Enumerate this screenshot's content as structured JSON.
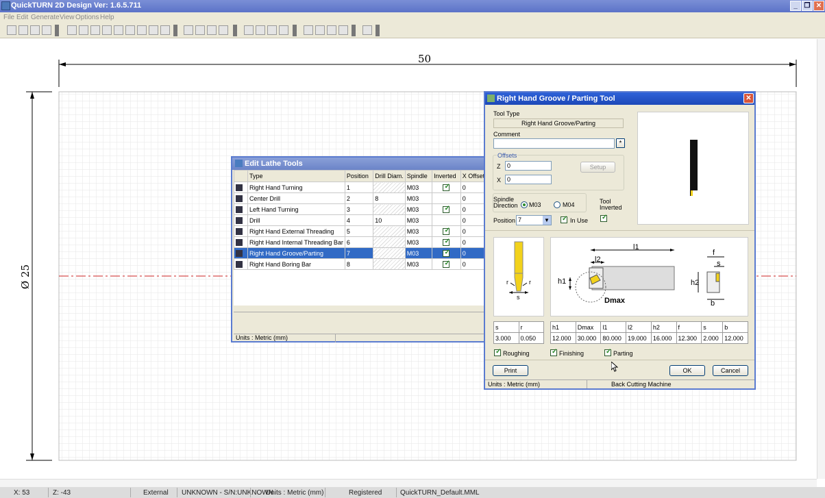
{
  "app": {
    "title": "QuickTURN 2D Design Ver: 1.6.5.711"
  },
  "menu": [
    "File",
    "Edit",
    "Generate",
    "View",
    "Options",
    "Help"
  ],
  "canvas": {
    "dim_length": "50",
    "dim_diameter": "Ø 25"
  },
  "edit_lathe_tools": {
    "title": "Edit Lathe Tools",
    "columns": [
      "Type",
      "Position",
      "Drill Diam.",
      "Spindle",
      "Inverted",
      "X Offset"
    ],
    "rows": [
      {
        "type": "Right Hand Turning",
        "position": "1",
        "drill": "",
        "spindle": "M03",
        "inverted": true,
        "xoffset": "0"
      },
      {
        "type": "Center Drill",
        "position": "2",
        "drill": "8",
        "spindle": "M03",
        "inverted": false,
        "xoffset": "0"
      },
      {
        "type": "Left Hand Turning",
        "position": "3",
        "drill": "",
        "spindle": "M03",
        "inverted": true,
        "xoffset": "0"
      },
      {
        "type": "Drill",
        "position": "4",
        "drill": "10",
        "spindle": "M03",
        "inverted": false,
        "xoffset": "0"
      },
      {
        "type": "Right Hand External Threading",
        "position": "5",
        "drill": "",
        "spindle": "M03",
        "inverted": true,
        "xoffset": "0"
      },
      {
        "type": "Right Hand Internal Threading Bar",
        "position": "6",
        "drill": "",
        "spindle": "M03",
        "inverted": true,
        "xoffset": "0"
      },
      {
        "type": "Right Hand Groove/Parting",
        "position": "7",
        "drill": "",
        "spindle": "M03",
        "inverted": true,
        "xoffset": "0"
      },
      {
        "type": "Right Hand Boring Bar",
        "position": "8",
        "drill": "",
        "spindle": "M03",
        "inverted": true,
        "xoffset": "0"
      }
    ],
    "selected_index": 6,
    "units": "Units : Metric (mm)"
  },
  "groove_dialog": {
    "title": "Right Hand Groove / Parting Tool",
    "tool_type_label": "Tool Type",
    "tool_type_value": "Right Hand Groove/Parting",
    "comment_label": "Comment",
    "comment_value": "",
    "comment_btn": "*",
    "offsets_label": "Offsets",
    "z_label": "Z",
    "z_value": "0",
    "x_label": "X",
    "x_value": "0",
    "setup_label": "Setup",
    "spindle_label": "Spindle\nDirection",
    "m03": "M03",
    "m04": "M04",
    "tool_inverted_label": "Tool\nInverted",
    "position_label": "Position",
    "position_value": "7",
    "in_use_label": "In Use",
    "diagram_labels": {
      "s": "s",
      "r": "r",
      "l1": "l1",
      "l2": "l2",
      "h1": "h1",
      "h2": "h2",
      "dmax": "Dmax",
      "f": "f",
      "b": "b"
    },
    "params_left": {
      "headers": [
        "s",
        "r"
      ],
      "values": [
        "3.000",
        "0.050"
      ]
    },
    "params_right": {
      "headers": [
        "h1",
        "Dmax",
        "l1",
        "l2",
        "h2",
        "f",
        "s",
        "b"
      ],
      "values": [
        "12.000",
        "30.000",
        "80.000",
        "19.000",
        "16.000",
        "12.300",
        "2.000",
        "12.000"
      ]
    },
    "roughing": "Roughing",
    "finishing": "Finishing",
    "parting": "Parting",
    "print": "Print",
    "ok": "OK",
    "cancel": "Cancel",
    "units": "Units : Metric (mm)",
    "machine": "Back Cutting Machine"
  },
  "statusbar": [
    "X: 53",
    "Z: -43",
    "External",
    "UNKNOWN - S/N:UNKNOWN",
    "Units : Metric (mm)",
    "Registered",
    "QuickTURN_Default.MML"
  ],
  "colors": {
    "accent": "#316ac5",
    "centerline": "#cc2222",
    "tool_yellow": "#f2d21c"
  }
}
